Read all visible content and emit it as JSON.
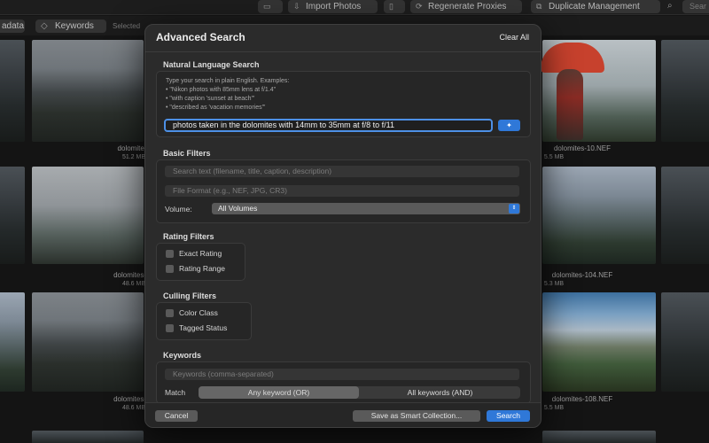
{
  "toolbar": {
    "import_label": "Import Photos",
    "regenerate_label": "Regenerate Proxies",
    "duplicate_label": "Duplicate Management",
    "search_placeholder": "Sear"
  },
  "subbar": {
    "metadata_label": "adata",
    "keywords_label": "Keywords",
    "selected_text": "Selected"
  },
  "grid": {
    "items": [
      {
        "name": "dolomites-",
        "size": "51.2 MB"
      },
      {
        "name": "dolomites-10.NEF",
        "size": "5.5 MB"
      },
      {
        "name": "dolomites-10",
        "size": "48.6 MB"
      },
      {
        "name": "dolomites-104.NEF",
        "size": "5.3 MB"
      },
      {
        "name": "dolomites-10",
        "size": "48.6 MB"
      },
      {
        "name": "dolomites-108.NEF",
        "size": "5.5 MB"
      }
    ]
  },
  "dialog": {
    "title": "Advanced Search",
    "clear_all": "Clear All",
    "nl": {
      "section_title": "Natural Language Search",
      "help_lines": [
        "Type your search in plain English. Examples:",
        "• \"Nikon photos with 85mm lens at f/1.4\"",
        "• \"with caption 'sunset at beach'\"",
        "• \"described as 'vacation memories'\""
      ],
      "query": "photos taken in the dolomites with 14mm to 35mm at f/8 to f/11"
    },
    "basic": {
      "section_title": "Basic Filters",
      "search_placeholder": "Search text (filename, title, caption, description)",
      "format_placeholder": "File Format (e.g., NEF, JPG, CR3)",
      "volume_label": "Volume:",
      "volume_value": "All Volumes"
    },
    "rating": {
      "section_title": "Rating Filters",
      "exact": "Exact Rating",
      "range": "Rating Range"
    },
    "culling": {
      "section_title": "Culling Filters",
      "color_class": "Color Class",
      "tagged_status": "Tagged Status"
    },
    "keywords": {
      "section_title": "Keywords",
      "placeholder": "Keywords (comma-separated)",
      "match_label": "Match",
      "options": [
        "Any keyword (OR)",
        "All keywords (AND)"
      ],
      "selected": "Any keyword (OR)"
    },
    "footer": {
      "cancel": "Cancel",
      "save_smart": "Save as Smart Collection...",
      "search": "Search"
    }
  },
  "colors": {
    "accent": "#2f78d8",
    "dialog_bg": "#2b2b2b",
    "focus_ring": "#4d90e6"
  }
}
